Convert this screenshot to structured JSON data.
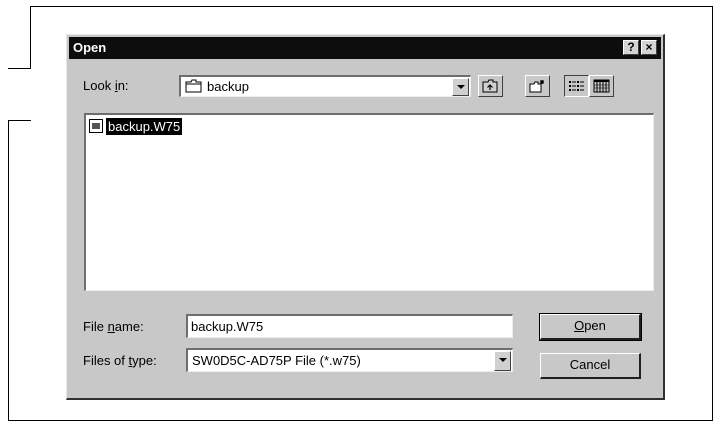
{
  "dialog": {
    "title": "Open",
    "help_label": "?",
    "close_label": "×"
  },
  "look_in": {
    "label_prefix": "Look ",
    "label_accel": "i",
    "label_suffix": "n:",
    "value": "backup"
  },
  "toolbar": {
    "buttons": [
      "up-one-level",
      "create-new-folder",
      "list-view",
      "details-view"
    ]
  },
  "files": [
    {
      "name": "backup.W75",
      "selected": true
    }
  ],
  "file_name": {
    "label_prefix": "File ",
    "label_accel": "n",
    "label_suffix": "ame:",
    "value": "backup.W75"
  },
  "file_type": {
    "label_prefix": "Files of ",
    "label_accel": "t",
    "label_suffix": "ype:",
    "value": "SW0D5C-AD75P File (*.w75)"
  },
  "buttons": {
    "open_accel": "O",
    "open_rest": "pen",
    "cancel": "Cancel"
  }
}
